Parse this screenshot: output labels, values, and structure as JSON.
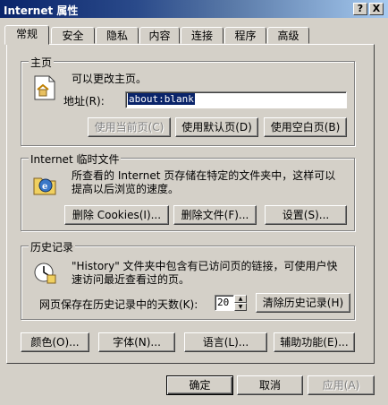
{
  "window": {
    "title": "Internet 属性",
    "help_label": "?",
    "close_label": "X"
  },
  "tabs": [
    "常规",
    "安全",
    "隐私",
    "内容",
    "连接",
    "程序",
    "高级"
  ],
  "home": {
    "group_title": "主页",
    "desc": "可以更改主页。",
    "address_label": "地址(R):",
    "address_value": "about:blank",
    "use_current": "使用当前页(C)",
    "use_default": "使用默认页(D)",
    "use_blank": "使用空白页(B)"
  },
  "temp": {
    "group_title": "Internet 临时文件",
    "desc_line1": "所查看的 Internet 页存储在特定的文件夹中，这样可以",
    "desc_line2": "提高以后浏览的速度。",
    "delete_cookies": "删除 Cookies(I)...",
    "delete_files": "删除文件(F)...",
    "settings": "设置(S)..."
  },
  "history": {
    "group_title": "历史记录",
    "desc_line1": "\"History\" 文件夹中包含有已访问页的链接，可使用户快",
    "desc_line2": "速访问最近查看过的页。",
    "days_label": "网页保存在历史记录中的天数(K):",
    "days_value": "20",
    "clear": "清除历史记录(H)"
  },
  "bottom": {
    "colors": "颜色(O)...",
    "fonts": "字体(N)...",
    "languages": "语言(L)...",
    "accessibility": "辅助功能(E)..."
  },
  "dialog": {
    "ok": "确定",
    "cancel": "取消",
    "apply": "应用(A)"
  }
}
